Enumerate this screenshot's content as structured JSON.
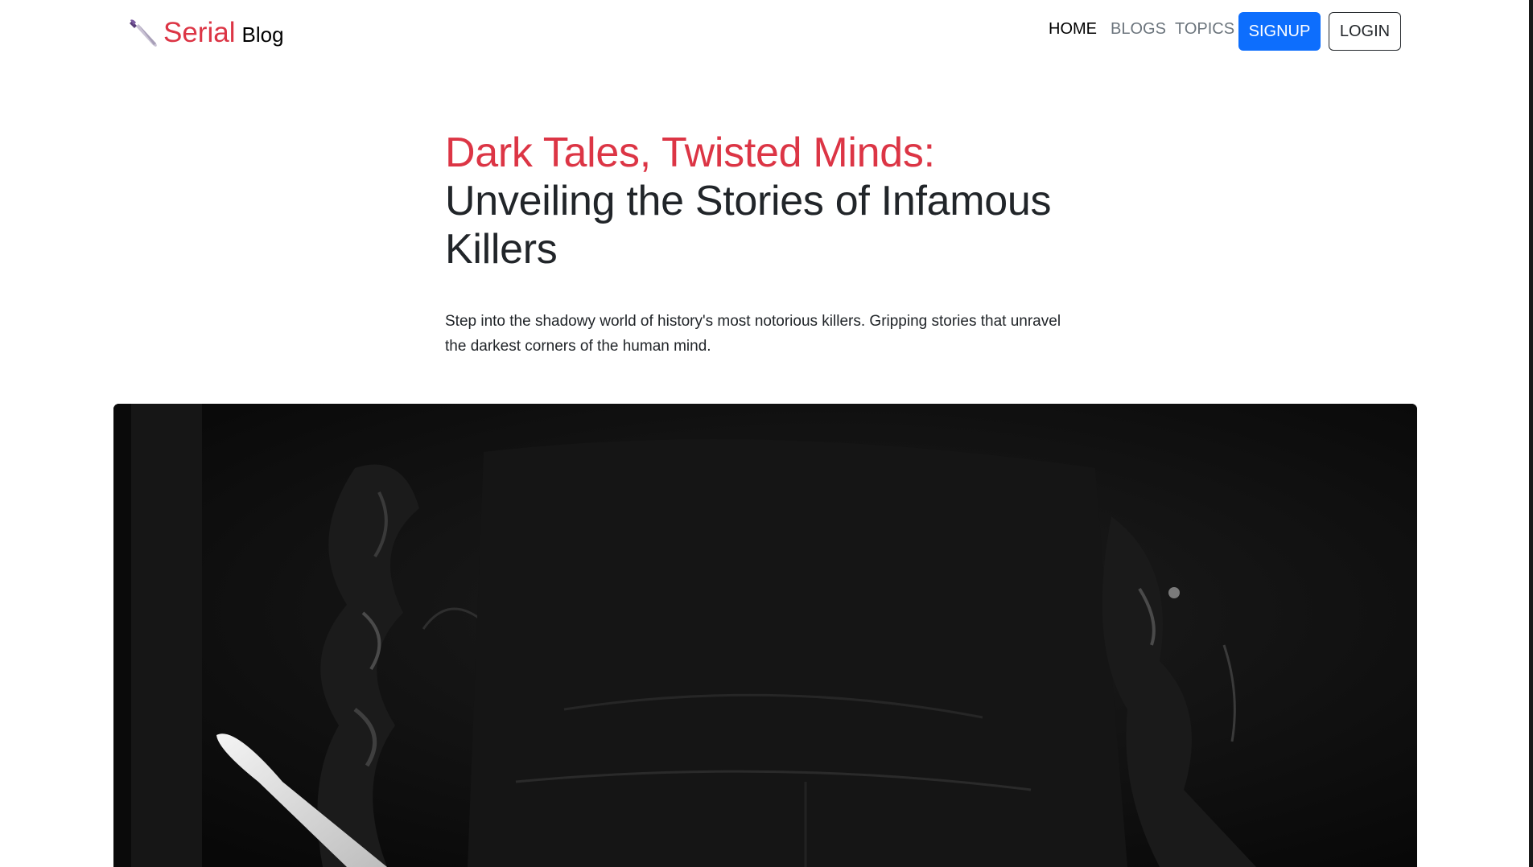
{
  "brand": {
    "icon": "knife-icon",
    "name": "Serial",
    "suffix": "Blog",
    "accent_color": "#dc3545"
  },
  "nav": {
    "items": [
      {
        "label": "HOME",
        "active": true
      },
      {
        "label": "BLOGS",
        "active": false
      },
      {
        "label": "TOPICS",
        "active": false
      }
    ],
    "signup_label": "SIGNUP",
    "login_label": "LOGIN",
    "signup_color": "#0d6efd"
  },
  "hero": {
    "title_accent": "Dark Tales, Twisted Minds:",
    "title_main": "Unveiling the Stories of Infamous Killers",
    "description": "Step into the shadowy world of history's most notorious killers. Gripping stories that unravel the darkest corners of the human mind."
  },
  "banner": {
    "image": "dark-figure-with-knife"
  }
}
